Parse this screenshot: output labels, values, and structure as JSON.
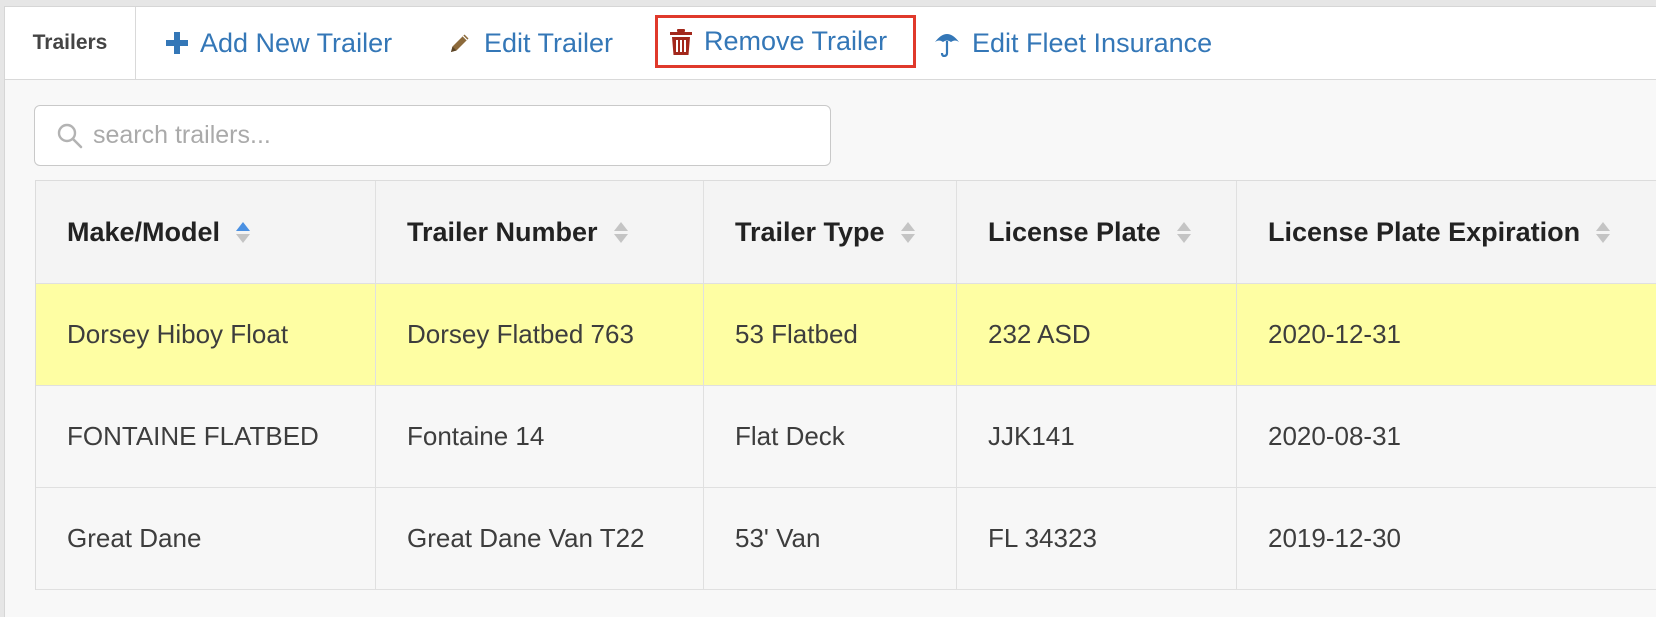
{
  "toolbar": {
    "title": "Trailers",
    "buttons": {
      "add": {
        "label": "Add New Trailer",
        "icon": "plus-icon"
      },
      "edit": {
        "label": "Edit Trailer",
        "icon": "pencil-icon"
      },
      "remove": {
        "label": "Remove Trailer",
        "icon": "trash-icon"
      },
      "insurance": {
        "label": "Edit Fleet Insurance",
        "icon": "umbrella-icon"
      }
    },
    "highlight_color": "#e0392b",
    "accent_color": "#3477b7"
  },
  "search": {
    "placeholder": "search trailers...",
    "value": "",
    "icon": "search-icon"
  },
  "table": {
    "columns": [
      {
        "label": "Make/Model",
        "sort": "ascending"
      },
      {
        "label": "Trailer Number",
        "sort": "none"
      },
      {
        "label": "Trailer Type",
        "sort": "none"
      },
      {
        "label": "License Plate",
        "sort": "none"
      },
      {
        "label": "License Plate Expiration",
        "sort": "none"
      }
    ],
    "rows": [
      {
        "selected": true,
        "cells": [
          "Dorsey Hiboy Float",
          "Dorsey Flatbed 763",
          "53 Flatbed",
          "232 ASD",
          "2020-12-31"
        ]
      },
      {
        "selected": false,
        "cells": [
          "FONTAINE FLATBED",
          "Fontaine 14",
          "Flat Deck",
          "JJK141",
          "2020-08-31"
        ]
      },
      {
        "selected": false,
        "cells": [
          "Great Dane",
          "Great Dane Van T22",
          "53' Van",
          "FL 34323",
          "2019-12-30"
        ]
      }
    ],
    "selected_row_color": "#fefea3"
  }
}
